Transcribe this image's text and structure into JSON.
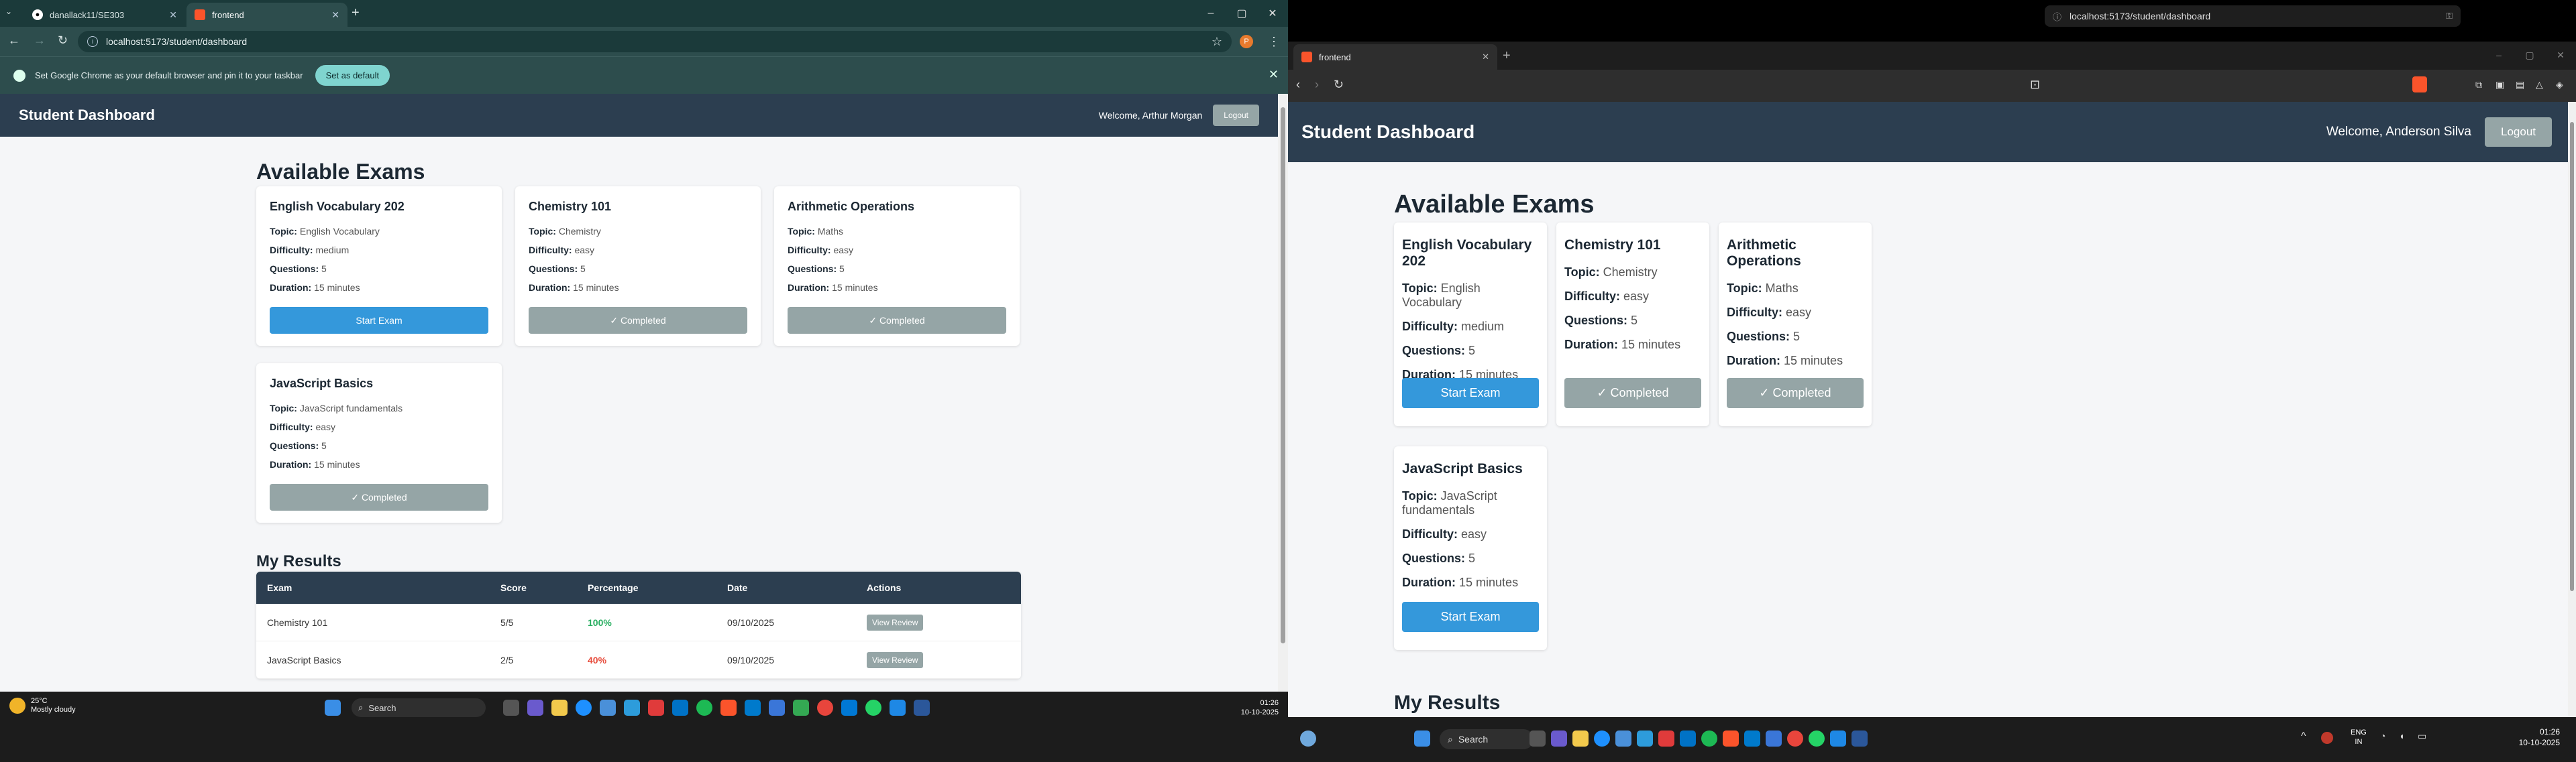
{
  "left": {
    "tabs": [
      {
        "title": "danallack11/SE303"
      },
      {
        "title": "frontend"
      }
    ],
    "url": "localhost:5173/student/dashboard",
    "profile_initial": "P",
    "infobar": {
      "message": "Set Google Chrome as your default browser and pin it to your taskbar",
      "button": "Set as default"
    },
    "header": {
      "brand": "Student Dashboard",
      "welcome": "Welcome, Arthur Morgan",
      "logout": "Logout"
    },
    "exams_title": "Available Exams",
    "exams": [
      {
        "name": "English Vocabulary 202",
        "topic": "English Vocabulary",
        "difficulty": "medium",
        "questions": "5",
        "duration": "15 minutes",
        "action": "Start Exam"
      },
      {
        "name": "Chemistry 101",
        "topic": "Chemistry",
        "difficulty": "easy",
        "questions": "5",
        "duration": "15 minutes",
        "action": "✓ Completed"
      },
      {
        "name": "Arithmetic Operations",
        "topic": "Maths",
        "difficulty": "easy",
        "questions": "5",
        "duration": "15 minutes",
        "action": "✓ Completed"
      },
      {
        "name": "JavaScript Basics",
        "topic": "JavaScript fundamentals",
        "difficulty": "easy",
        "questions": "5",
        "duration": "15 minutes",
        "action": "✓ Completed"
      }
    ],
    "labels": {
      "topic": "Topic:",
      "difficulty": "Difficulty:",
      "questions": "Questions:",
      "duration": "Duration:"
    },
    "results_title": "My Results",
    "results_headers": [
      "Exam",
      "Score",
      "Percentage",
      "Date",
      "Actions"
    ],
    "results_rows": [
      {
        "exam": "Chemistry 101",
        "score": "5/5",
        "percentage": "100%",
        "date": "09/10/2025",
        "action": "View Review"
      },
      {
        "exam": "JavaScript Basics",
        "score": "2/5",
        "percentage": "40%",
        "date": "09/10/2025",
        "action": "View Review"
      }
    ],
    "taskbar": {
      "weather_temp": "25°C",
      "weather_desc": "Mostly cloudy",
      "search": "Search",
      "time": "01:26",
      "date": "10-10-2025"
    }
  },
  "right": {
    "tab": {
      "title": "frontend"
    },
    "url": "localhost:5173/student/dashboard",
    "header": {
      "brand": "Student Dashboard",
      "welcome": "Welcome, Anderson Silva",
      "logout": "Logout"
    },
    "exams_title": "Available Exams",
    "exams": [
      {
        "name": "English Vocabulary 202",
        "topic": "English Vocabulary",
        "difficulty": "medium",
        "questions": "5",
        "duration": "15 minutes",
        "action": "Start Exam"
      },
      {
        "name": "Chemistry 101",
        "topic": "Chemistry",
        "difficulty": "easy",
        "questions": "5",
        "duration": "15 minutes",
        "action": "✓ Completed"
      },
      {
        "name": "Arithmetic Operations",
        "topic": "Maths",
        "difficulty": "easy",
        "questions": "5",
        "duration": "15 minutes",
        "action": "✓ Completed"
      },
      {
        "name": "JavaScript Basics",
        "topic": "JavaScript fundamentals",
        "difficulty": "easy",
        "questions": "5",
        "duration": "15 minutes",
        "action": "Start Exam"
      }
    ],
    "labels": {
      "topic": "Topic:",
      "difficulty": "Difficulty:",
      "questions": "Questions:",
      "duration": "Duration:"
    },
    "results_title": "My Results",
    "taskbar": {
      "search": "Search",
      "lang": "ENG",
      "region": "IN",
      "time": "01:26",
      "date": "10-10-2025"
    }
  },
  "colors": {
    "header": "#2c3e50",
    "start": "#3498db",
    "completed": "#95a5a6",
    "good": "#27ae60",
    "bad": "#e74c3c"
  }
}
